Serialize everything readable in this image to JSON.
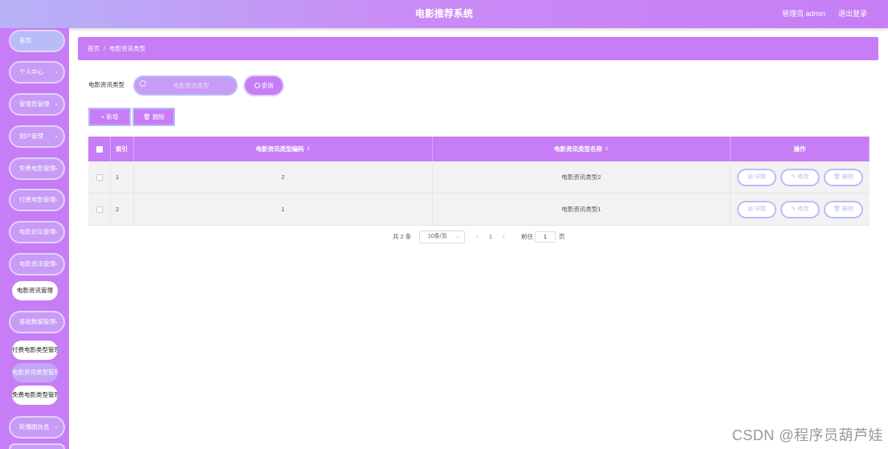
{
  "header": {
    "title": "电影推荐系统",
    "user": "管理员 admin",
    "logout": "退出登录"
  },
  "sidebar": {
    "items": [
      {
        "label": "首页",
        "chevron": ""
      },
      {
        "label": "个人中心",
        "chevron": "⌄"
      },
      {
        "label": "管理员管理",
        "chevron": "⌄"
      },
      {
        "label": "用户管理",
        "chevron": "⌄"
      },
      {
        "label": "免费电影管理",
        "chevron": "⌄"
      },
      {
        "label": "付费电影管理",
        "chevron": "⌄"
      },
      {
        "label": "电影论坛管理",
        "chevron": "⌄"
      },
      {
        "label": "电影资讯管理",
        "chevron": "⌄"
      },
      {
        "label": "电影资讯管理",
        "chevron": ""
      },
      {
        "label": "基础数据管理",
        "chevron": "⌄"
      },
      {
        "label": "付费电影类型管理",
        "chevron": ""
      },
      {
        "label": "电影资讯类型管理",
        "chevron": ""
      },
      {
        "label": "免费电影类型管理",
        "chevron": ""
      },
      {
        "label": "轮播图信息",
        "chevron": "⌄"
      }
    ]
  },
  "breadcrumb": {
    "home": "首页",
    "separator": "/",
    "current": "电影资讯类型"
  },
  "search": {
    "label": "电影资讯类型",
    "placeholder": "电影资讯类型",
    "value": "",
    "button": "查询"
  },
  "actions": {
    "add": "+ 新增",
    "delete": "删除"
  },
  "table": {
    "headers": {
      "index": "索引",
      "code": "电影资讯类型编码",
      "name": "电影资讯类型名称",
      "ops": "操作",
      "sort": "⇕"
    },
    "rows": [
      {
        "index": "1",
        "code": "2",
        "name": "电影资讯类型2"
      },
      {
        "index": "2",
        "code": "1",
        "name": "电影资讯类型1"
      }
    ],
    "row_ops": {
      "detail": "详情",
      "edit": "修改",
      "delete": "删除"
    }
  },
  "pagination": {
    "total": "共 2 条",
    "page_size": "10条/页",
    "prev": "‹",
    "current": "1",
    "next": "›",
    "goto": "前往",
    "goto_value": "1",
    "page_unit": "页"
  },
  "watermark": "CSDN @程序员葫芦娃",
  "colors": {
    "accent": "#c77df5",
    "header_start": "#b7b2f7",
    "button_border": "#b8bdf7"
  }
}
